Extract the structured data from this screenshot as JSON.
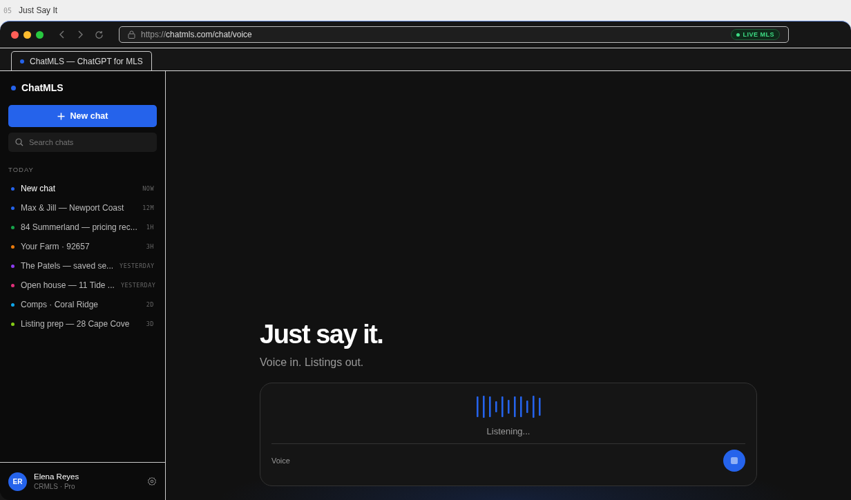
{
  "page_header": {
    "number": "05",
    "title": "Just Say It"
  },
  "browser": {
    "url_prefix": "https://",
    "url_main": "chatmls.com/chat/voice",
    "badge": "LIVE MLS",
    "tab": "ChatMLS — ChatGPT for MLS"
  },
  "sidebar": {
    "brand": "ChatMLS",
    "new_chat": "New chat",
    "search": {
      "placeholder": "Search chats"
    },
    "section": "TODAY",
    "items": [
      {
        "label": "New chat",
        "time": "NOW",
        "color": "#2563eb",
        "selected": true
      },
      {
        "label": "Max & Jill — Newport Coast",
        "time": "12M",
        "color": "#2563eb",
        "selected": false
      },
      {
        "label": "84 Summerland — pricing rec...",
        "time": "1H",
        "color": "#16a34a",
        "selected": false
      },
      {
        "label": "Your Farm · 92657",
        "time": "3H",
        "color": "#ea7a0c",
        "selected": false
      },
      {
        "label": "The Patels — saved se...",
        "time": "YESTERDAY",
        "color": "#8b3cf0",
        "selected": false
      },
      {
        "label": "Open house — 11 Tide ...",
        "time": "YESTERDAY",
        "color": "#e0307a",
        "selected": false
      },
      {
        "label": "Comps · Coral Ridge",
        "time": "2D",
        "color": "#0ea5e9",
        "selected": false
      },
      {
        "label": "Listing prep — 28 Cape Cove",
        "time": "3D",
        "color": "#84cc16",
        "selected": false
      }
    ],
    "user": {
      "initials": "ER",
      "name": "Elena Reyes",
      "plan": "CRMLS · Pro"
    }
  },
  "main": {
    "heading": "Just say it.",
    "subheading": "Voice in. Listings out.",
    "composer": {
      "status": "Listening...",
      "mode": "Voice"
    }
  }
}
